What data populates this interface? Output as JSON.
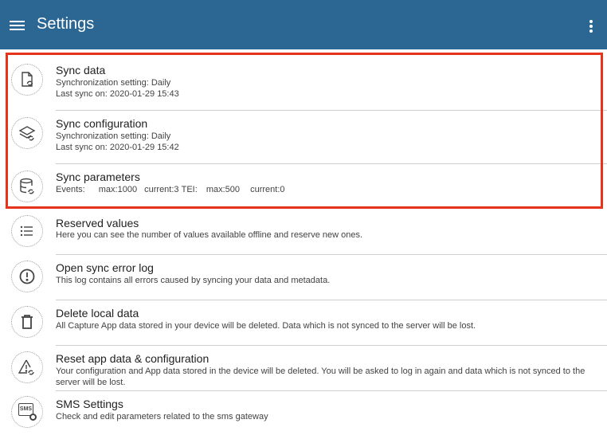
{
  "header": {
    "title": "Settings",
    "menu_icon": "menu-icon",
    "more_icon": "more-vert-icon",
    "background": "#2c6693"
  },
  "highlight_color": "#e8331c",
  "items": [
    {
      "id": "sync-data",
      "icon": "file-sync-icon",
      "title": "Sync data",
      "line1": "Synchronization setting: Daily",
      "line2": "Last sync on: 2020-01-29 15:43"
    },
    {
      "id": "sync-configuration",
      "icon": "layers-sync-icon",
      "title": "Sync configuration",
      "line1": "Synchronization setting: Daily",
      "line2": "Last sync on: 2020-01-29 15:42"
    },
    {
      "id": "sync-parameters",
      "icon": "database-sync-icon",
      "title": "Sync parameters",
      "stats": {
        "events_label": "Events:",
        "events_max": "max:1000",
        "events_current": "current:3",
        "tei_label": "TEI:",
        "tei_max": "max:500",
        "tei_current": "current:0"
      }
    },
    {
      "id": "reserved-values",
      "icon": "list-icon",
      "title": "Reserved values",
      "line1": "Here you can see the number of values available offline and reserve new ones."
    },
    {
      "id": "sync-error-log",
      "icon": "error-icon",
      "title": "Open sync error log",
      "line1": "This log contains all errors caused by syncing your data and metadata."
    },
    {
      "id": "delete-local-data",
      "icon": "trash-icon",
      "title": "Delete local data",
      "line1": "All Capture App data stored in your device will be deleted. Data which is not synced to the server will be lost."
    },
    {
      "id": "reset-app",
      "icon": "warning-reset-icon",
      "title": "Reset app data & configuration",
      "line1": "Your configuration and App data stored in the device will be deleted. You will be asked to log in again and data which is not synced to the server will be lost."
    },
    {
      "id": "sms-settings",
      "icon": "sms-settings-icon",
      "icon_text": "SMS",
      "title": "SMS Settings",
      "line1": "Check and edit parameters related to the sms gateway"
    }
  ]
}
